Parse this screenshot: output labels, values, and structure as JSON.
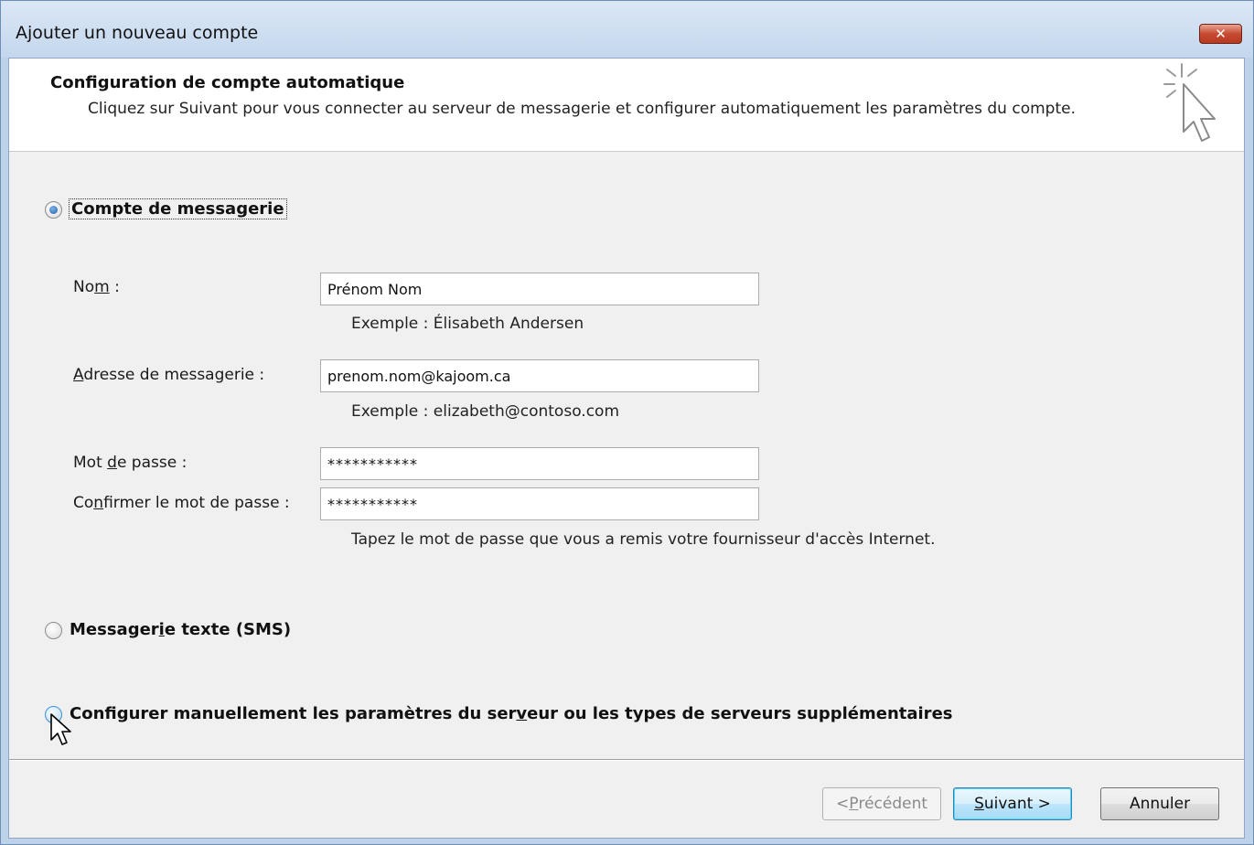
{
  "window": {
    "title": "Ajouter un nouveau compte",
    "close_glyph": "✕"
  },
  "header": {
    "title": "Configuration de compte automatique",
    "description": "Cliquez sur Suivant pour vous connecter au serveur de messagerie et configurer automatiquement les paramètres du compte.",
    "icon": "wizard-cursor-sparkle-icon"
  },
  "options": {
    "email_account": {
      "label_pre": "Compte de messagerie",
      "checked": true
    },
    "sms": {
      "label_pre": "Messager",
      "label_key": "i",
      "label_post": "e texte (SMS)",
      "checked": false
    },
    "manual": {
      "label_pre": "Configurer manuellement les paramètres du ser",
      "label_key": "v",
      "label_post": "eur ou les types de serveurs supplémentaires",
      "checked": false
    }
  },
  "form": {
    "name": {
      "label_pre": "No",
      "label_key": "m",
      "label_post": " :",
      "value": "Prénom Nom",
      "hint": "Exemple : Élisabeth Andersen"
    },
    "email": {
      "label_pre": "",
      "label_key": "A",
      "label_post": "dresse de messagerie :",
      "value": "prenom.nom@kajoom.ca",
      "hint": "Exemple : elizabeth@contoso.com"
    },
    "password": {
      "label_pre": "Mot ",
      "label_key": "d",
      "label_post": "e passe :",
      "value": "***********"
    },
    "confirm_password": {
      "label_pre": "Co",
      "label_key": "n",
      "label_post": "firmer le mot de passe :",
      "value": "***********",
      "hint": "Tapez le mot de passe que vous a remis votre fournisseur d'accès Internet."
    }
  },
  "buttons": {
    "previous": {
      "pre": "< ",
      "key": "P",
      "post": "récédent",
      "enabled": false
    },
    "next": {
      "pre": "",
      "key": "S",
      "post": "uivant >",
      "enabled": true
    },
    "cancel": {
      "label": "Annuler"
    }
  },
  "colors": {
    "titlebar": "#c4d7ee",
    "close_button": "#c74a32",
    "radio_checked": "#1d5ea8",
    "default_button": "#a7d9f5"
  }
}
